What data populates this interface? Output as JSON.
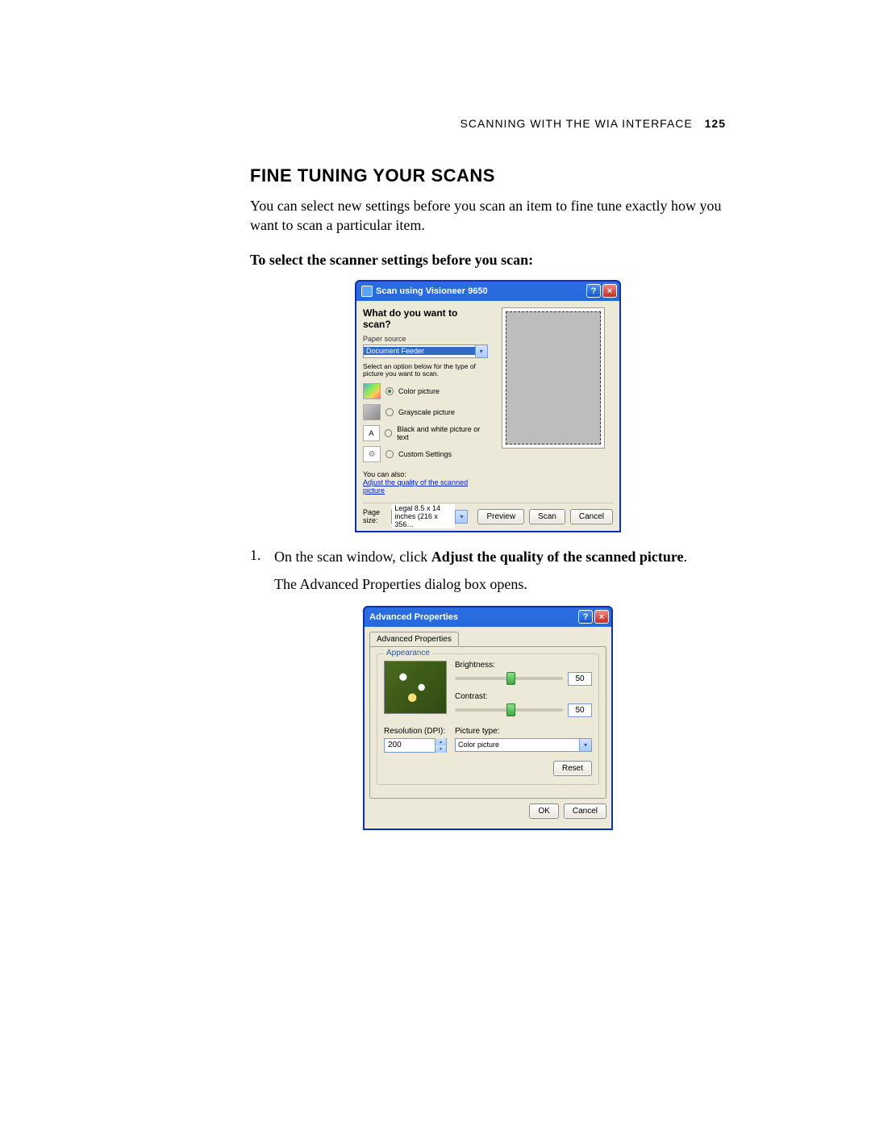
{
  "header": {
    "running_head": "SCANNING WITH THE WIA INTERFACE",
    "page_number": "125"
  },
  "section": {
    "heading": "FINE TUNING YOUR SCANS",
    "intro": "You can select new settings before you scan an item to fine tune exactly how you want to scan a particular item.",
    "sub_bold": "To select the scanner settings before you scan:"
  },
  "step1": {
    "number": "1.",
    "pre": "On the scan window, click ",
    "bold": "Adjust the quality of the scanned picture",
    "post": ".",
    "after": "The Advanced Properties dialog box opens."
  },
  "scan_dialog": {
    "title": "Scan using Visioneer 9650",
    "question": "What do you want to scan?",
    "paper_source_label": "Paper source",
    "paper_source_value": "Document Feeder",
    "option_instruction": "Select an option below for the type of picture you want to scan.",
    "options": {
      "color": "Color picture",
      "gray": "Grayscale picture",
      "bw": "Black and white picture or text",
      "custom": "Custom Settings"
    },
    "also_label": "You can also:",
    "adjust_link": "Adjust the quality of the scanned picture",
    "page_size_label": "Page size:",
    "page_size_value": "Legal 8.5 x 14 inches (216 x 356…",
    "btn_preview": "Preview",
    "btn_scan": "Scan",
    "btn_cancel": "Cancel"
  },
  "adv_dialog": {
    "title": "Advanced Properties",
    "tab": "Advanced Properties",
    "group_appearance": "Appearance",
    "brightness_label": "Brightness:",
    "brightness_value": "50",
    "contrast_label": "Contrast:",
    "contrast_value": "50",
    "resolution_label": "Resolution (DPI):",
    "resolution_value": "200",
    "picture_type_label": "Picture type:",
    "picture_type_value": "Color picture",
    "btn_reset": "Reset",
    "btn_ok": "OK",
    "btn_cancel": "Cancel"
  }
}
